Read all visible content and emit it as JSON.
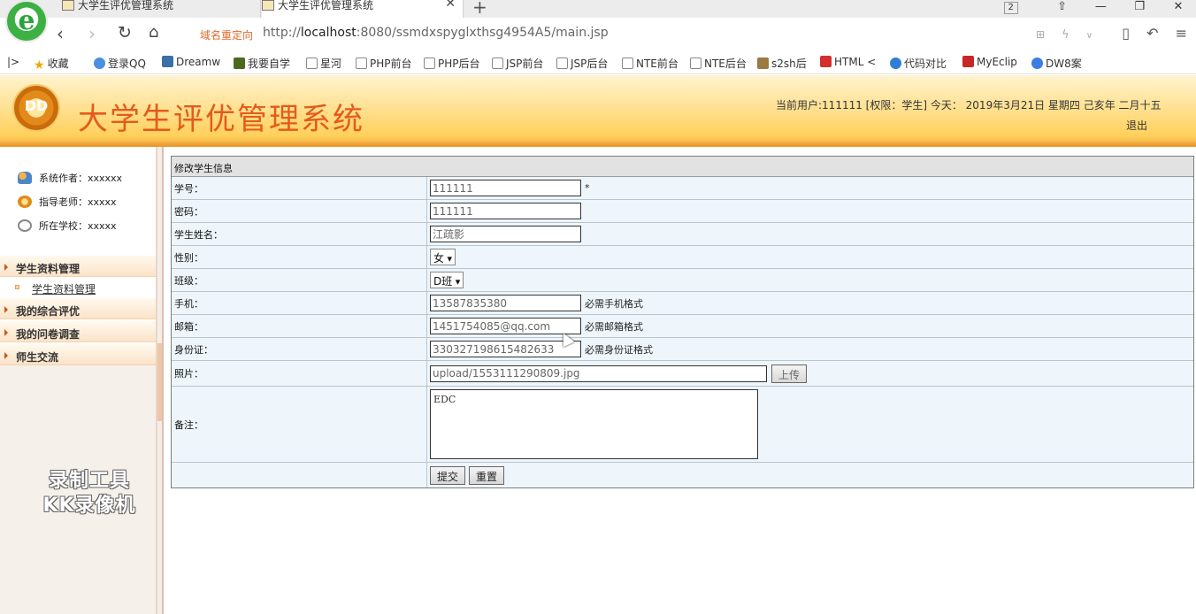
{
  "browser": {
    "tabs": [
      {
        "title": "大学生评优管理系统",
        "active": false
      },
      {
        "title": "大学生评优管理系统",
        "active": true
      }
    ],
    "tab_count": "2",
    "redirect_label": "域名重定向",
    "url_prefix": "http://",
    "url_host": "localhost",
    "url_rest": ":8080/ssmdxspyglxthsg4954A5/main.jsp",
    "bookmarks": [
      "收藏",
      "登录QQ",
      "Dreamw",
      "我要自学",
      "星河",
      "PHP前台",
      "PHP后台",
      "JSP前台",
      "JSP后台",
      "NTE前台",
      "NTE后台",
      "s2sh后",
      "HTML <",
      "代码对比",
      "MyEclip",
      "DW8案"
    ]
  },
  "header": {
    "title": "大学生评优管理系统",
    "logo_text": "DD",
    "user_info": "当前用户:111111 [权限：学生] 今天： 2019年3月21日 星期四 己亥年 二月十五",
    "logout": "退出"
  },
  "sidebar": {
    "info": [
      {
        "label": "系统作者：xxxxxx"
      },
      {
        "label": "指导老师：xxxxx"
      },
      {
        "label": "所在学校：xxxxx"
      }
    ],
    "menus": [
      {
        "label": "学生资料管理"
      },
      {
        "label": "我的综合评优"
      },
      {
        "label": "我的问卷调查"
      },
      {
        "label": "师生交流"
      }
    ],
    "submenu": "学生资料管理",
    "watermark_line1": "录制工具",
    "watermark_line2": "KK录像机"
  },
  "form": {
    "caption": "修改学生信息",
    "fields": {
      "student_id": {
        "label": "学号：",
        "value": "111111",
        "required_mark": "*"
      },
      "password": {
        "label": "密码：",
        "value": "111111"
      },
      "name": {
        "label": "学生姓名：",
        "value": "江疏影"
      },
      "gender": {
        "label": "性别：",
        "value": "女"
      },
      "class": {
        "label": "班级：",
        "value": "D班"
      },
      "phone": {
        "label": "手机：",
        "value": "13587835380",
        "hint": "必需手机格式"
      },
      "email": {
        "label": "邮箱：",
        "value": "1451754085@qq.com",
        "hint": "必需邮箱格式"
      },
      "id_card": {
        "label": "身份证：",
        "value": "330327198615482633",
        "hint": "必需身份证格式"
      },
      "photo": {
        "label": "照片：",
        "value": "upload/1553111290809.jpg",
        "button": "上传"
      },
      "remark": {
        "label": "备注：",
        "value": "EDC"
      }
    },
    "submit": "提交",
    "reset": "重置"
  }
}
